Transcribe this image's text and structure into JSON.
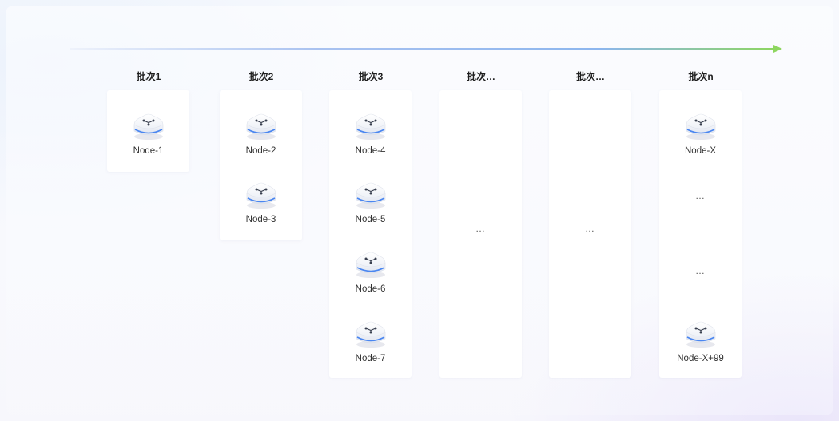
{
  "colors": {
    "arrow_start": "#e3e9f7",
    "arrow_mid": "#8fb3ee",
    "arrow_end": "#8dd65f",
    "card_bg": "#ffffff",
    "title_text": "#1f1f1f",
    "node_text": "#333333"
  },
  "node_icon_name": "router-node-icon",
  "batches": [
    {
      "title": "批次1",
      "nodes": [
        "Node-1"
      ]
    },
    {
      "title": "批次2",
      "nodes": [
        "Node-2",
        "Node-3"
      ]
    },
    {
      "title": "批次3",
      "nodes": [
        "Node-4",
        "Node-5",
        "Node-6",
        "Node-7"
      ]
    },
    {
      "title": "批次…",
      "placeholder": "…"
    },
    {
      "title": "批次…",
      "placeholder": "…"
    },
    {
      "title": "批次n",
      "nodes": [
        "Node-X",
        "Node-X+99"
      ],
      "gap_markers": [
        "…",
        "…"
      ]
    }
  ]
}
